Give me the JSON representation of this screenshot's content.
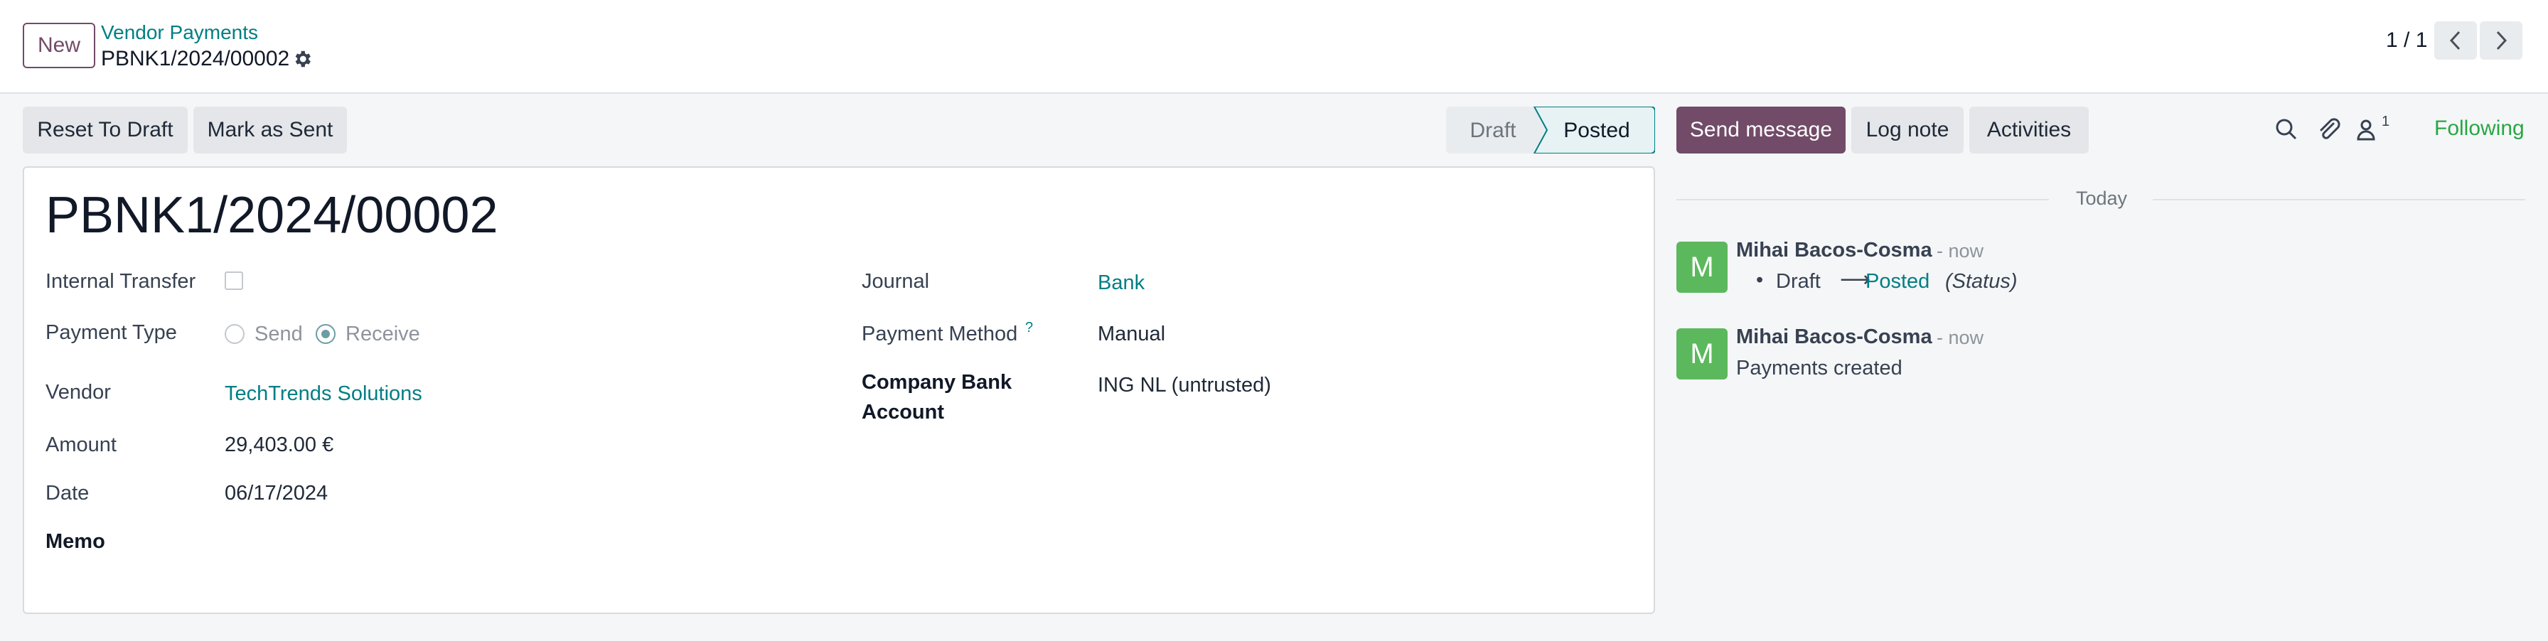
{
  "header": {
    "new_label": "New",
    "breadcrumb_parent": "Vendor Payments",
    "record_name": "PBNK1/2024/00002",
    "pager_value": "1 / 1"
  },
  "actions": {
    "reset_to_draft": "Reset To Draft",
    "mark_as_sent": "Mark as Sent"
  },
  "statusbar": {
    "stages": [
      "Draft",
      "Posted"
    ],
    "current": "Posted"
  },
  "form": {
    "title": "PBNK1/2024/00002",
    "left_fields": {
      "internal_transfer_label": "Internal Transfer",
      "internal_transfer_checked": false,
      "payment_type_label": "Payment Type",
      "payment_type_options": [
        "Send",
        "Receive"
      ],
      "payment_type_selected": "Receive",
      "vendor_label": "Vendor",
      "vendor_value": "TechTrends Solutions",
      "amount_label": "Amount",
      "amount_value": "29,403.00 €",
      "date_label": "Date",
      "date_value": "06/17/2024",
      "memo_label": "Memo"
    },
    "right_fields": {
      "journal_label": "Journal",
      "journal_value": "Bank",
      "payment_method_label": "Payment Method",
      "payment_method_help": "?",
      "payment_method_value": "Manual",
      "company_bank_label_line1": "Company Bank",
      "company_bank_label_line2": "Account",
      "company_bank_value": "ING NL (untrusted)"
    }
  },
  "chatter": {
    "send_message": "Send message",
    "log_note": "Log note",
    "activities": "Activities",
    "followers_count": "1",
    "following": "Following",
    "date_separator": "Today",
    "messages": [
      {
        "avatar_letter": "M",
        "author": "Mihai Bacos-Cosma",
        "time": "- now",
        "tracking_old": "Draft",
        "tracking_arrow": "⟶",
        "tracking_new": "Posted",
        "tracking_field": "(Status)"
      },
      {
        "avatar_letter": "M",
        "author": "Mihai Bacos-Cosma",
        "time": "- now",
        "body": "Payments created"
      }
    ]
  },
  "colors": {
    "brand": "#714b67",
    "link": "#017e84",
    "following": "#28a745",
    "avatar": "#5cb85c"
  }
}
